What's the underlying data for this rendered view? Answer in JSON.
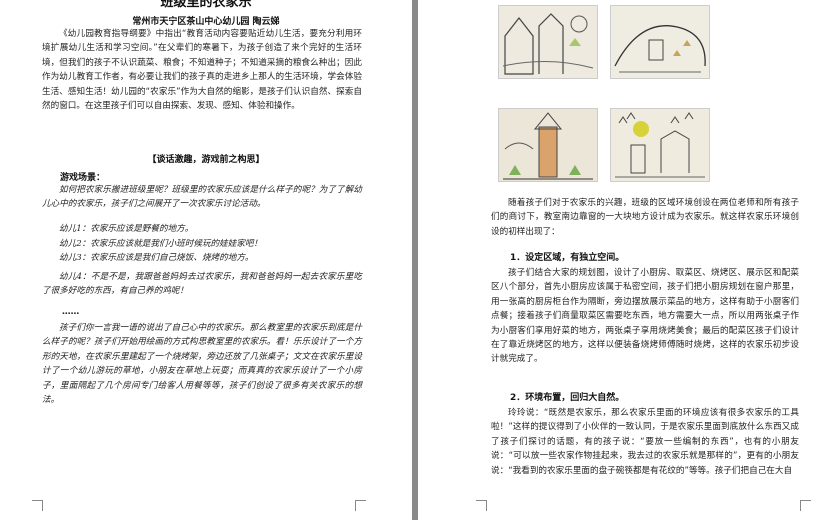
{
  "document": {
    "title": "班级里的农家乐",
    "byline": "常州市天宁区茶山中心幼儿园  陶云娣",
    "intro": "《幼儿园教育指导纲要》中指出“教育活动内容要贴近幼儿生活，要充分利用环境扩展幼儿生活和学习空间。”在父辈们的寒暑下，为孩子创造了来个完好的生活环境，但我们的孩子不认识蔬菜、粮食；不知道种子；不知道采摘的粮食么种出；因此作为幼儿教育工作者，有必要让我们的孩子真的走进乡上那人的生活环境，学会体验生活、感知生活！幼儿园的“农家乐”作为大自然的缩影，是孩子们认识自然、探索自然的窗口。在这里孩子们可以自由探索、发现、感知、体验和操作。",
    "section_heading": "【谈话激趣，游戏前之构思】",
    "scene_label": "游戏场景：",
    "scene_text": "如何把农家乐搬进班级里呢？班级里的农家乐应该是什么样子的呢？为了了解幼儿心中的农家乐，孩子们之间展开了一次农家乐讨论活动。",
    "child_1": "幼儿1：农家乐应该是野餐的地方。",
    "child_2": "幼儿2：农家乐应该就是我们小班时候玩的娃娃家吧！",
    "child_3": "幼儿3：农家乐应该是我们自己烧饭、烧烤的地方。",
    "child_4": "幼儿4：不是不是，我跟爸爸妈妈去过农家乐，我和爸爸妈妈一起去农家乐里吃了很多好吃的东西，有自己养的鸡呢！",
    "ellipsis": "……",
    "closing": "孩子们你一言我一语的说出了自己心中的农家乐。那么教室里的农家乐到底是什么样子的呢？孩子们开始用绘画的方式构思教室里的农家乐。看！乐乐设计了一个方形的天地，在农家乐里建起了一个烧烤架，旁边还放了几张桌子；文文在农家乐里设计了一个幼儿游玩的草地，小朋友在草地上玩耍；而真真的农家乐设计了一个小房子，里面隔起了几个房间专门给客人用餐等等，孩子们创设了很多有关农家乐的想法。"
  },
  "right_page": {
    "drawings": [
      "child-drawing-1",
      "child-drawing-2",
      "child-drawing-3",
      "child-drawing-4"
    ],
    "para_1": "随着孩子们对于农家乐的兴趣，班级的区域环境创设在两位老师和所有孩子们的商讨下，教室南边靠窗的一大块地方设计成为农家乐。就这样农家乐环境创设的初样出现了：",
    "section_1": "1．设定区域，有独立空间。",
    "para_2": "孩子们结合大家的规划图，设计了小厨房、取菜区、烧烤区、展示区和配菜区八个部分，首先小厨房应该属于私密空间，孩子们把小厨房规划在窗户那里，用一张高的厨房柜台作为隔断，旁边摆放展示菜品的地方，这样有助于小厨客们点餐；接着孩子们商量取菜区需要吃东西，地方需要大一点，所以用两张桌子作为小厨客们享用好菜的地方，两张桌子享用烧烤美食；最后的配菜区孩子们设计在了靠近烧烤区的地方，这样以便装备烧烤师傅随时烧烤，这样的农家乐初步设计就完成了。",
    "section_2": "2．环境布置，回归大自然。",
    "para_3": "玲玲说：“既然是农家乐，那么农家乐里面的环境应该有很多农家乐的工具啦！”这样的提议得到了小伙伴的一致认同，于是农家乐里面到底放什么东西又成了孩子们探讨的话题，有的孩子说：“要放一些编制的东西”，也有的小朋友说：“可以放一些农家作物挂起来，我去过的农家乐就是那样的”，更有的小朋友说：“我看到的农家乐里面的盘子碗筷都是有花纹的”等等。孩子们把自己在大自"
  }
}
